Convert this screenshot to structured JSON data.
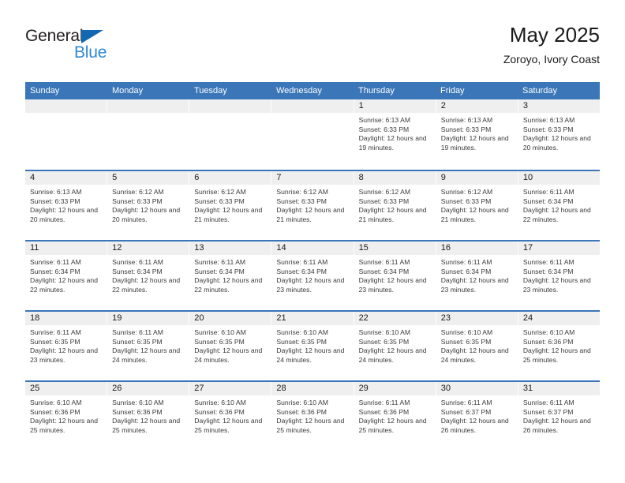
{
  "brand": {
    "name_part1": "General",
    "name_part2": "Blue",
    "triangle_color": "#1268b3",
    "blue_color": "#2e8ad6"
  },
  "header": {
    "title": "May 2025",
    "subtitle": "Zoroyo, Ivory Coast",
    "header_bg_color": "#3a76b8",
    "day_band_color": "#efefef"
  },
  "weekdays": [
    "Sunday",
    "Monday",
    "Tuesday",
    "Wednesday",
    "Thursday",
    "Friday",
    "Saturday"
  ],
  "weeks": [
    [
      {
        "day": "",
        "sunrise": "",
        "sunset": "",
        "daylight": ""
      },
      {
        "day": "",
        "sunrise": "",
        "sunset": "",
        "daylight": ""
      },
      {
        "day": "",
        "sunrise": "",
        "sunset": "",
        "daylight": ""
      },
      {
        "day": "",
        "sunrise": "",
        "sunset": "",
        "daylight": ""
      },
      {
        "day": "1",
        "sunrise": "Sunrise: 6:13 AM",
        "sunset": "Sunset: 6:33 PM",
        "daylight": "Daylight: 12 hours and 19 minutes."
      },
      {
        "day": "2",
        "sunrise": "Sunrise: 6:13 AM",
        "sunset": "Sunset: 6:33 PM",
        "daylight": "Daylight: 12 hours and 19 minutes."
      },
      {
        "day": "3",
        "sunrise": "Sunrise: 6:13 AM",
        "sunset": "Sunset: 6:33 PM",
        "daylight": "Daylight: 12 hours and 20 minutes."
      }
    ],
    [
      {
        "day": "4",
        "sunrise": "Sunrise: 6:13 AM",
        "sunset": "Sunset: 6:33 PM",
        "daylight": "Daylight: 12 hours and 20 minutes."
      },
      {
        "day": "5",
        "sunrise": "Sunrise: 6:12 AM",
        "sunset": "Sunset: 6:33 PM",
        "daylight": "Daylight: 12 hours and 20 minutes."
      },
      {
        "day": "6",
        "sunrise": "Sunrise: 6:12 AM",
        "sunset": "Sunset: 6:33 PM",
        "daylight": "Daylight: 12 hours and 21 minutes."
      },
      {
        "day": "7",
        "sunrise": "Sunrise: 6:12 AM",
        "sunset": "Sunset: 6:33 PM",
        "daylight": "Daylight: 12 hours and 21 minutes."
      },
      {
        "day": "8",
        "sunrise": "Sunrise: 6:12 AM",
        "sunset": "Sunset: 6:33 PM",
        "daylight": "Daylight: 12 hours and 21 minutes."
      },
      {
        "day": "9",
        "sunrise": "Sunrise: 6:12 AM",
        "sunset": "Sunset: 6:33 PM",
        "daylight": "Daylight: 12 hours and 21 minutes."
      },
      {
        "day": "10",
        "sunrise": "Sunrise: 6:11 AM",
        "sunset": "Sunset: 6:34 PM",
        "daylight": "Daylight: 12 hours and 22 minutes."
      }
    ],
    [
      {
        "day": "11",
        "sunrise": "Sunrise: 6:11 AM",
        "sunset": "Sunset: 6:34 PM",
        "daylight": "Daylight: 12 hours and 22 minutes."
      },
      {
        "day": "12",
        "sunrise": "Sunrise: 6:11 AM",
        "sunset": "Sunset: 6:34 PM",
        "daylight": "Daylight: 12 hours and 22 minutes."
      },
      {
        "day": "13",
        "sunrise": "Sunrise: 6:11 AM",
        "sunset": "Sunset: 6:34 PM",
        "daylight": "Daylight: 12 hours and 22 minutes."
      },
      {
        "day": "14",
        "sunrise": "Sunrise: 6:11 AM",
        "sunset": "Sunset: 6:34 PM",
        "daylight": "Daylight: 12 hours and 23 minutes."
      },
      {
        "day": "15",
        "sunrise": "Sunrise: 6:11 AM",
        "sunset": "Sunset: 6:34 PM",
        "daylight": "Daylight: 12 hours and 23 minutes."
      },
      {
        "day": "16",
        "sunrise": "Sunrise: 6:11 AM",
        "sunset": "Sunset: 6:34 PM",
        "daylight": "Daylight: 12 hours and 23 minutes."
      },
      {
        "day": "17",
        "sunrise": "Sunrise: 6:11 AM",
        "sunset": "Sunset: 6:34 PM",
        "daylight": "Daylight: 12 hours and 23 minutes."
      }
    ],
    [
      {
        "day": "18",
        "sunrise": "Sunrise: 6:11 AM",
        "sunset": "Sunset: 6:35 PM",
        "daylight": "Daylight: 12 hours and 23 minutes."
      },
      {
        "day": "19",
        "sunrise": "Sunrise: 6:11 AM",
        "sunset": "Sunset: 6:35 PM",
        "daylight": "Daylight: 12 hours and 24 minutes."
      },
      {
        "day": "20",
        "sunrise": "Sunrise: 6:10 AM",
        "sunset": "Sunset: 6:35 PM",
        "daylight": "Daylight: 12 hours and 24 minutes."
      },
      {
        "day": "21",
        "sunrise": "Sunrise: 6:10 AM",
        "sunset": "Sunset: 6:35 PM",
        "daylight": "Daylight: 12 hours and 24 minutes."
      },
      {
        "day": "22",
        "sunrise": "Sunrise: 6:10 AM",
        "sunset": "Sunset: 6:35 PM",
        "daylight": "Daylight: 12 hours and 24 minutes."
      },
      {
        "day": "23",
        "sunrise": "Sunrise: 6:10 AM",
        "sunset": "Sunset: 6:35 PM",
        "daylight": "Daylight: 12 hours and 24 minutes."
      },
      {
        "day": "24",
        "sunrise": "Sunrise: 6:10 AM",
        "sunset": "Sunset: 6:36 PM",
        "daylight": "Daylight: 12 hours and 25 minutes."
      }
    ],
    [
      {
        "day": "25",
        "sunrise": "Sunrise: 6:10 AM",
        "sunset": "Sunset: 6:36 PM",
        "daylight": "Daylight: 12 hours and 25 minutes."
      },
      {
        "day": "26",
        "sunrise": "Sunrise: 6:10 AM",
        "sunset": "Sunset: 6:36 PM",
        "daylight": "Daylight: 12 hours and 25 minutes."
      },
      {
        "day": "27",
        "sunrise": "Sunrise: 6:10 AM",
        "sunset": "Sunset: 6:36 PM",
        "daylight": "Daylight: 12 hours and 25 minutes."
      },
      {
        "day": "28",
        "sunrise": "Sunrise: 6:10 AM",
        "sunset": "Sunset: 6:36 PM",
        "daylight": "Daylight: 12 hours and 25 minutes."
      },
      {
        "day": "29",
        "sunrise": "Sunrise: 6:11 AM",
        "sunset": "Sunset: 6:36 PM",
        "daylight": "Daylight: 12 hours and 25 minutes."
      },
      {
        "day": "30",
        "sunrise": "Sunrise: 6:11 AM",
        "sunset": "Sunset: 6:37 PM",
        "daylight": "Daylight: 12 hours and 26 minutes."
      },
      {
        "day": "31",
        "sunrise": "Sunrise: 6:11 AM",
        "sunset": "Sunset: 6:37 PM",
        "daylight": "Daylight: 12 hours and 26 minutes."
      }
    ]
  ]
}
